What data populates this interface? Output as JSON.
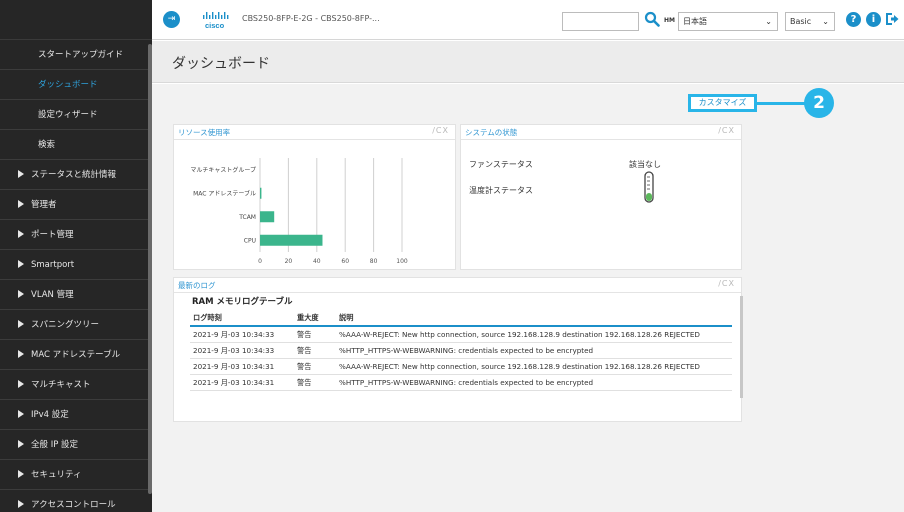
{
  "sidebar": {
    "items": [
      {
        "label": "スタートアップガイド",
        "type": "child"
      },
      {
        "label": "ダッシュボード",
        "type": "child",
        "active": true
      },
      {
        "label": "設定ウィザード",
        "type": "child"
      },
      {
        "label": "検索",
        "type": "child"
      },
      {
        "label": "ステータスと統計情報",
        "type": "group"
      },
      {
        "label": "管理者",
        "type": "group"
      },
      {
        "label": "ポート管理",
        "type": "group"
      },
      {
        "label": "Smartport",
        "type": "group"
      },
      {
        "label": "VLAN 管理",
        "type": "group"
      },
      {
        "label": "スパニングツリー",
        "type": "group"
      },
      {
        "label": "MAC アドレステーブル",
        "type": "group"
      },
      {
        "label": "マルチキャスト",
        "type": "group"
      },
      {
        "label": "IPv4 設定",
        "type": "group"
      },
      {
        "label": "全般 IP 設定",
        "type": "group"
      },
      {
        "label": "セキュリティ",
        "type": "group"
      },
      {
        "label": "アクセスコントロール",
        "type": "group"
      }
    ]
  },
  "header": {
    "device_name": "CBS250-8FP-E-2G - CBS250-8FP-...",
    "search_value": "",
    "hm_label": "HM",
    "language": "日本語",
    "mode": "Basic",
    "accent": "#1b8fc9"
  },
  "page": {
    "title": "ダッシュボード",
    "customize_label": "カスタマイズ",
    "callout_number": "2",
    "callout_color": "#29b5e8"
  },
  "widgets": {
    "resources": {
      "title": "リソース使用率",
      "tools": "/CX",
      "chart_data": {
        "type": "bar",
        "orientation": "horizontal",
        "categories": [
          "マルチキャストグループ",
          "MAC アドレステーブル",
          "TCAM",
          "CPU"
        ],
        "values": [
          0,
          1,
          10,
          44
        ],
        "xlim": [
          0,
          100
        ],
        "xticks": [
          "0",
          "20",
          "40",
          "60",
          "80",
          "100"
        ],
        "color": "#3bb58c"
      }
    },
    "system": {
      "title": "システムの状態",
      "tools": "/CX",
      "rows": [
        {
          "label": "ファンステータス",
          "value": "該当なし"
        },
        {
          "label": "温度計ステータス",
          "value": ""
        }
      ]
    },
    "log": {
      "title": "最新のログ",
      "tools": "/CX",
      "subtitle": "RAM メモリログテーブル",
      "columns": [
        "ログ時刻",
        "重大度",
        "説明"
      ],
      "rows": [
        {
          "time": "2021-9 月-03 10:34:33",
          "severity": "警告",
          "desc": "%AAA-W-REJECT: New http connection, source 192.168.128.9 destination 192.168.128.26 REJECTED"
        },
        {
          "time": "2021-9 月-03 10:34:33",
          "severity": "警告",
          "desc": "%HTTP_HTTPS-W-WEBWARNING: credentials expected to be encrypted"
        },
        {
          "time": "2021-9 月-03 10:34:31",
          "severity": "警告",
          "desc": "%AAA-W-REJECT: New http connection, source 192.168.128.9 destination 192.168.128.26 REJECTED"
        },
        {
          "time": "2021-9 月-03 10:34:31",
          "severity": "警告",
          "desc": "%HTTP_HTTPS-W-WEBWARNING: credentials expected to be encrypted"
        }
      ]
    }
  }
}
